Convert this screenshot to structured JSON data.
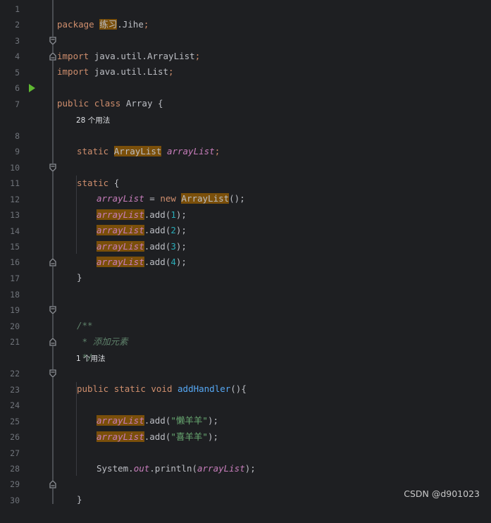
{
  "lines": [
    {
      "n": "1"
    },
    {
      "n": "2"
    },
    {
      "n": "3"
    },
    {
      "n": "4"
    },
    {
      "n": "5"
    },
    {
      "n": "6"
    },
    {
      "n": "7"
    },
    {
      "n": "8"
    },
    {
      "n": "9"
    },
    {
      "n": "10"
    },
    {
      "n": "11"
    },
    {
      "n": "12"
    },
    {
      "n": "13"
    },
    {
      "n": "14"
    },
    {
      "n": "15"
    },
    {
      "n": "16"
    },
    {
      "n": "17"
    },
    {
      "n": "18"
    },
    {
      "n": "19"
    },
    {
      "n": "20"
    },
    {
      "n": "21"
    },
    {
      "n": "22"
    },
    {
      "n": "23"
    },
    {
      "n": "24"
    },
    {
      "n": "25"
    },
    {
      "n": "26"
    },
    {
      "n": "27"
    },
    {
      "n": "28"
    },
    {
      "n": "29"
    },
    {
      "n": "30"
    }
  ],
  "code": {
    "package_kw": "package",
    "package_hl": "练习",
    "package_rest": ".Jihe",
    "semi": ";",
    "import_kw": "import",
    "import1": "java.util.ArrayList",
    "import2": "java.util.List",
    "public_kw": "public",
    "class_kw": "class",
    "class_name": "Array",
    "open_brace": "{",
    "close_brace": "}",
    "static_kw": "static",
    "arraylist_type": "ArrayList",
    "field_name": "arrayList",
    "eq": " = ",
    "new_kw": "new",
    "ctor_call": "();",
    "add_method": ".add(",
    "close_paren_semi": ");",
    "nums": [
      "1",
      "2",
      "3",
      "4"
    ],
    "doc_open": "/**",
    "doc_text": " * 添加元素",
    "doc_close": " */",
    "void_kw": "void",
    "method_name": "addHandler",
    "method_sig_rest": "(){",
    "str1": "\"懒羊羊\"",
    "str2": "\"喜羊羊\"",
    "system": "System.",
    "out": "out",
    "println": ".println(",
    "paren_semi": ");"
  },
  "hints": {
    "usages_28": "28 个用法",
    "usages_1": "1 个用法"
  },
  "watermark": "CSDN @d901023"
}
